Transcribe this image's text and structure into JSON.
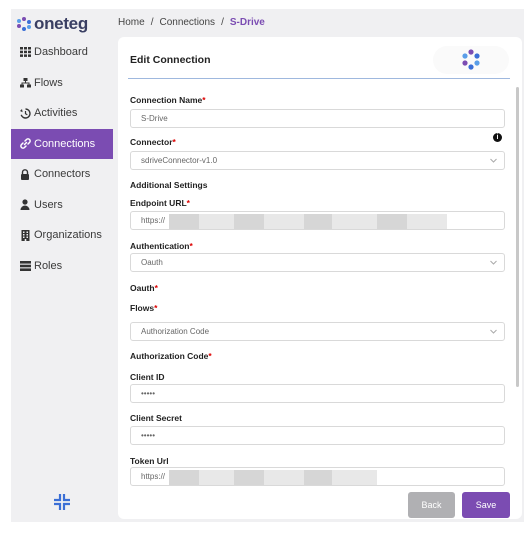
{
  "brand": {
    "name": "oneteg",
    "logo_colors": [
      "#7b4cb2",
      "#3b6fd6",
      "#5a9ee8"
    ]
  },
  "sidebar": {
    "items": [
      {
        "label": "Dashboard",
        "icon": "grid-icon",
        "active": false
      },
      {
        "label": "Flows",
        "icon": "flows-icon",
        "active": false
      },
      {
        "label": "Activities",
        "icon": "history-icon",
        "active": false
      },
      {
        "label": "Connections",
        "icon": "link-icon",
        "active": true
      },
      {
        "label": "Connectors",
        "icon": "lock-icon",
        "active": false
      },
      {
        "label": "Users",
        "icon": "user-icon",
        "active": false
      },
      {
        "label": "Organizations",
        "icon": "building-icon",
        "active": false
      },
      {
        "label": "Roles",
        "icon": "roles-icon",
        "active": false
      }
    ],
    "collapse_icon": "collapse-icon",
    "active_color": "#7b4cb2"
  },
  "breadcrumb": {
    "items": [
      "Home",
      "Connections",
      "S-Drive"
    ],
    "separator": "/"
  },
  "form": {
    "title": "Edit Connection",
    "connection_name": {
      "label": "Connection Name",
      "value": "S-Drive"
    },
    "connector": {
      "label": "Connector",
      "value": "sdriveConnector-v1.0",
      "info_icon": "info-icon"
    },
    "additional_settings": "Additional Settings",
    "endpoint_url": {
      "label": "Endpoint URL",
      "value": "https://"
    },
    "authentication": {
      "label": "Authentication",
      "value": "Oauth"
    },
    "oauth_section": "Oauth",
    "flows": {
      "label": "Flows",
      "value": "Authorization Code"
    },
    "authorization_code": "Authorization Code",
    "client_id": {
      "label": "Client ID",
      "value": "•••••"
    },
    "client_secret": {
      "label": "Client Secret",
      "value": "•••••"
    },
    "token_url": {
      "label": "Token Url",
      "value": "https://"
    },
    "required_marker": "*"
  },
  "actions": {
    "back_label": "Back",
    "save_label": "Save"
  }
}
